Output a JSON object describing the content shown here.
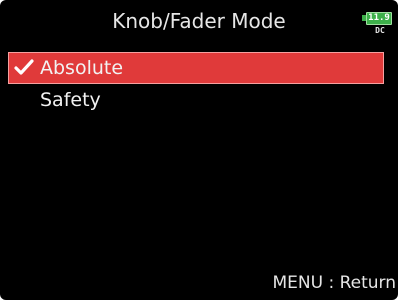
{
  "header": {
    "title": "Knob/Fader Mode",
    "battery": {
      "level": "11.9",
      "source": "DC",
      "icon": "battery-icon",
      "color": "#3db04a"
    }
  },
  "menu": {
    "items": [
      {
        "label": "Absolute",
        "selected": true,
        "checked": true,
        "icon": "checkmark-icon"
      },
      {
        "label": "Safety",
        "selected": false,
        "checked": false
      }
    ],
    "highlight_color": "#e03a3a"
  },
  "footer": {
    "hint": "MENU : Return"
  }
}
